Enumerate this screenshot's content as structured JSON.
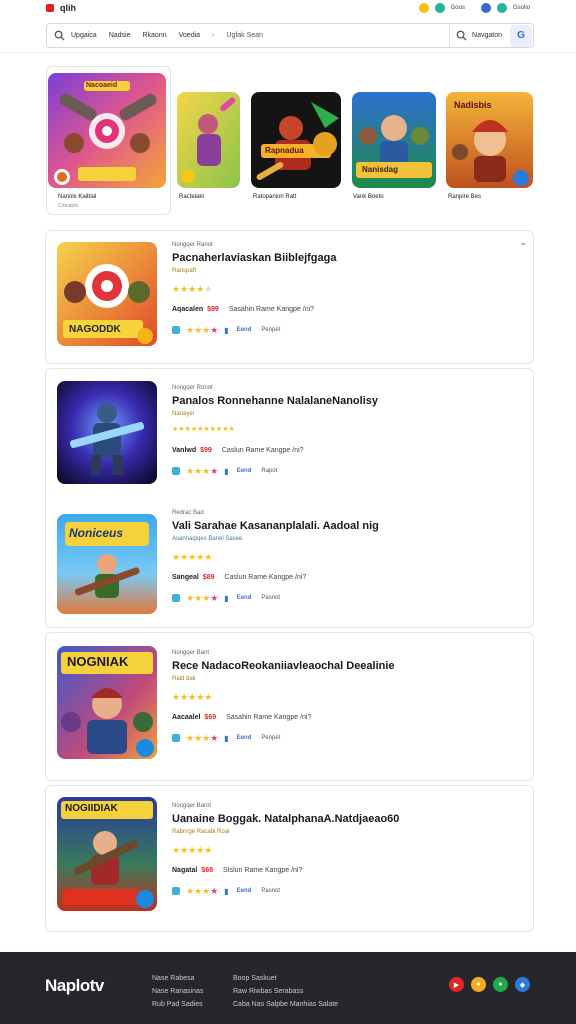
{
  "app": {
    "brand": "qlih",
    "top_links": [
      "Goos",
      "Gsolio"
    ]
  },
  "search": {
    "chips": [
      "Upgaica",
      "Nadsie",
      "Rkaonn",
      "Voedia"
    ],
    "placeholder": "Ugfak Sean",
    "nav_label": "Navgaton"
  },
  "featured": [
    {
      "label": "Nanolx Kaiblal",
      "sub": "Crocatox"
    },
    {
      "label": "Ractelakt",
      "sub": ""
    },
    {
      "label": "Ratopanion Ratt",
      "sub": ""
    },
    {
      "label": "Vank Boeto",
      "sub": ""
    },
    {
      "label": "Ranpire Bes",
      "sub": ""
    }
  ],
  "featured_art_text": [
    "Nacoaeid",
    "Rapnadua",
    "Nanisdag",
    "Nadisbis"
  ],
  "games": [
    {
      "category": "Nongqer Ranot",
      "title": "Pacnaherlaviaskan Biiblejfgaga",
      "subtitle": "Ranspaft",
      "art_text": "NAGODDK",
      "stars": 4,
      "price_label": "Aqacalen",
      "price": "$99",
      "note": "Sasahin Rame Kangpe /ni?",
      "meta_link": "Eend",
      "meta_end": "Penpet"
    },
    {
      "category": "Nongqer Ronot",
      "title": "Panalos Ronnehanne NalalaneNanolisy",
      "subtitle": "Nanayel",
      "art_text": "",
      "stars": 5,
      "price_label": "Vanlwd",
      "price": "$99",
      "note": "Caslun Rame Kangpe /ni?",
      "meta_link": "Eend",
      "meta_end": "Rapot"
    },
    {
      "category": "Redrac Bad",
      "title": "Vali Sarahae Kasananplalali. Aadoal nig",
      "subtitle": "Asannaqiqes Banel Sasee",
      "art_text": "Noniceus",
      "stars": 5,
      "price_label": "Sangeal",
      "price": "$89",
      "note": "Caslun Rame Kangpe /ni?",
      "meta_link": "Eend",
      "meta_end": "Pasnot"
    },
    {
      "category": "Nongqer Bant",
      "title": "Rece NadacoReokaniiavleaochal Deealinie",
      "subtitle": "Rald dak",
      "art_text": "NOGNIAK",
      "stars": 5,
      "price_label": "Aacaalel",
      "price": "$69",
      "note": "Sasahin Rame Kangpe /ni?",
      "meta_link": "Eend",
      "meta_end": "Penpet"
    },
    {
      "category": "Nongqer Barot",
      "title": "Uanaine Boggak. NatalphanaA.Natdjaeao60",
      "subtitle": "Rabnrge Racabi Roal",
      "art_text": "NOGIIDIAK",
      "stars": 5,
      "price_label": "Nagatal",
      "price": "$69",
      "note": "Stslun Rame Kangpe /ni?",
      "meta_link": "Eend",
      "meta_end": "Pasnot"
    }
  ],
  "footer": {
    "logo": "Naplotv",
    "col1": [
      "Nase Rabesa",
      "Nase Ranasinas",
      "Rub Pad Sadies"
    ],
    "col2": [
      "Boop Saskuet",
      "Raw Riwbas Serabass",
      "Caba Nas Salpbe Manhias Salate"
    ]
  },
  "colors": {
    "accent_red": "#e02828",
    "star": "#f2c21b",
    "link": "#3b74c7",
    "footer_bg": "#26272c"
  }
}
